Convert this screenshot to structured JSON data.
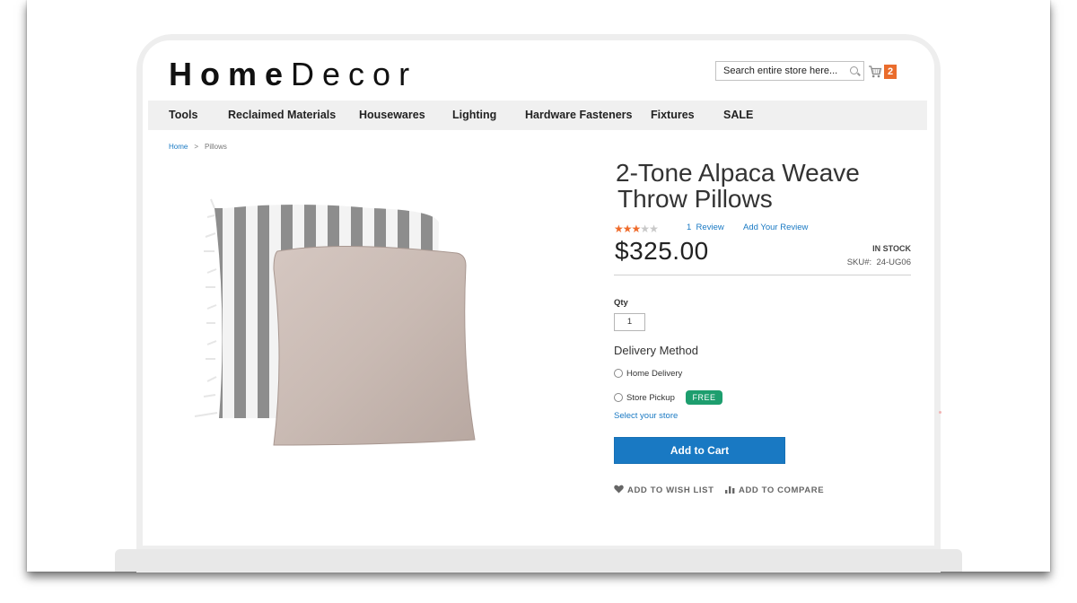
{
  "header": {
    "logo_home": "Home",
    "logo_decor": "Decor",
    "search_placeholder": "Search entire store here...",
    "cart_count": "2"
  },
  "nav": {
    "items": [
      "Tools",
      "Reclaimed Materials",
      "Housewares",
      "Lighting",
      "Hardware Fasteners",
      "Fixtures",
      "SALE"
    ]
  },
  "breadcrumb": {
    "home": "Home",
    "separator": ">",
    "current": "Pillows"
  },
  "product": {
    "title_line1": "2-Tone Alpaca Weave",
    "title_line2": "Throw Pillows",
    "rating": 3,
    "rating_max": 5,
    "review_link": "1  Review",
    "add_review": "Add Your Review",
    "price": "$325.00",
    "stock": "IN STOCK",
    "sku_label": "SKU#:",
    "sku": "24-UG06",
    "qty_label": "Qty",
    "qty_value": "1",
    "delivery_title": "Delivery Method",
    "delivery_options": [
      {
        "label": "Home Delivery"
      },
      {
        "label": "Store Pickup",
        "badge": "FREE"
      }
    ],
    "select_store": "Select your store",
    "add_to_cart": "Add to Cart",
    "wishlist": "ADD TO WISH LIST",
    "compare": "ADD TO COMPARE"
  },
  "colors": {
    "accent_blue": "#1979c3",
    "star_orange": "#ef6b2b",
    "badge_green": "#1d9e6e",
    "cart_badge": "#ea6c2c"
  },
  "icons": {
    "search": "search-icon",
    "cart": "cart-icon",
    "wishlist": "heart-icon",
    "compare": "bar-chart-icon"
  }
}
